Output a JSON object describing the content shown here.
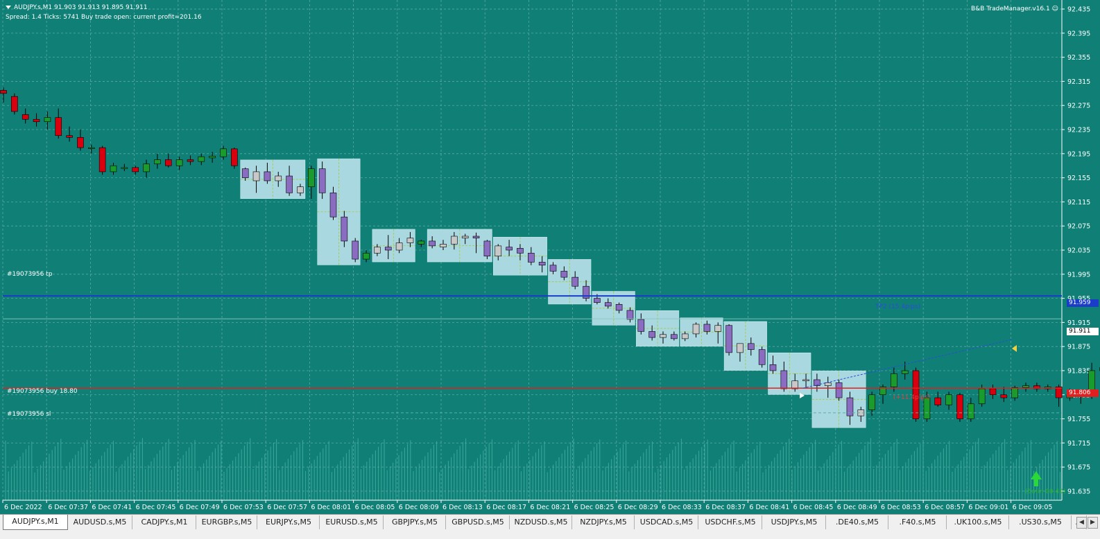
{
  "header": {
    "symbol_line": "AUDJPY.s,M1  91.903 91.913 91.895 91.911",
    "info_line": "Spread: 1.4   Ticks: 5741   Buy trade open: current profit=201.16",
    "ea_name": "B&B TradeManager.v16.1"
  },
  "price_axis": {
    "labels": [
      "92.435",
      "92.395",
      "92.355",
      "92.315",
      "92.275",
      "92.235",
      "92.195",
      "92.155",
      "92.115",
      "92.075",
      "92.035",
      "91.995",
      "91.955",
      "91.915",
      "91.875",
      "91.835",
      "91.795",
      "91.755",
      "91.715",
      "91.675",
      "91.635"
    ],
    "current_price": "91.911",
    "tp_price": "91.959",
    "entry_price": "91.806"
  },
  "time_axis": {
    "labels": [
      "6 Dec 2022",
      "6 Dec 07:37",
      "6 Dec 07:41",
      "6 Dec 07:45",
      "6 Dec 07:49",
      "6 Dec 07:53",
      "6 Dec 07:57",
      "6 Dec 08:01",
      "6 Dec 08:05",
      "6 Dec 08:09",
      "6 Dec 08:13",
      "6 Dec 08:17",
      "6 Dec 08:21",
      "6 Dec 08:25",
      "6 Dec 08:29",
      "6 Dec 08:33",
      "6 Dec 08:37",
      "6 Dec 08:41",
      "6 Dec 08:45",
      "6 Dec 08:49",
      "6 Dec 08:53",
      "6 Dec 08:57",
      "6 Dec 09:01",
      "6 Dec 09:05"
    ]
  },
  "trade_labels": {
    "tp": "#19073956 tp",
    "buy": "#19073956 buy 18.80",
    "sl": "#19073956 sl",
    "tp2": "TP2 (15.4pips)",
    "entry_tag": "(+11.4pips)",
    "timer": "(5min 08:40)"
  },
  "colors": {
    "background": "#108077",
    "bull": "#1a9c2c",
    "bear": "#d8000e",
    "box": "#a9d8e0",
    "box_candle": "#8a6cc0",
    "tp_line": "#1a3cc8",
    "entry_line": "#e02020",
    "grid": "#5aa8a0"
  },
  "tabs": [
    "AUDJPY.s,M1",
    "AUDUSD.s,M5",
    "CADJPY.s,M1",
    "EURGBP.s,M5",
    "EURJPY.s,M5",
    "EURUSD.s,M5",
    "GBPJPY.s,M5",
    "GBPUSD.s,M5",
    "NZDUSD.s,M5",
    "NZDJPY.s,M5",
    "USDCAD.s,M5",
    "USDCHF.s,M5",
    "USDJPY.s,M5",
    ".DE40.s,M5",
    ".F40.s,M5",
    ".UK100.s,M5",
    ".US30.s,M5",
    ".U"
  ],
  "active_tab": "AUDJPY.s,M1",
  "chart_data": {
    "type": "candlestick",
    "candles": [
      {
        "o": 92.3,
        "h": 92.305,
        "l": 92.28,
        "c": 92.295
      },
      {
        "o": 92.29,
        "h": 92.295,
        "l": 92.26,
        "c": 92.265
      },
      {
        "o": 92.26,
        "h": 92.27,
        "l": 92.245,
        "c": 92.252
      },
      {
        "o": 92.252,
        "h": 92.262,
        "l": 92.24,
        "c": 92.248
      },
      {
        "o": 92.248,
        "h": 92.265,
        "l": 92.235,
        "c": 92.255
      },
      {
        "o": 92.255,
        "h": 92.27,
        "l": 92.22,
        "c": 92.225
      },
      {
        "o": 92.225,
        "h": 92.24,
        "l": 92.215,
        "c": 92.222
      },
      {
        "o": 92.222,
        "h": 92.235,
        "l": 92.2,
        "c": 92.205
      },
      {
        "o": 92.205,
        "h": 92.21,
        "l": 92.195,
        "c": 92.205
      },
      {
        "o": 92.205,
        "h": 92.208,
        "l": 92.16,
        "c": 92.165
      },
      {
        "o": 92.165,
        "h": 92.18,
        "l": 92.16,
        "c": 92.175
      },
      {
        "o": 92.172,
        "h": 92.178,
        "l": 92.166,
        "c": 92.172
      },
      {
        "o": 92.172,
        "h": 92.175,
        "l": 92.16,
        "c": 92.165
      },
      {
        "o": 92.165,
        "h": 92.185,
        "l": 92.155,
        "c": 92.178
      },
      {
        "o": 92.178,
        "h": 92.195,
        "l": 92.17,
        "c": 92.185
      },
      {
        "o": 92.185,
        "h": 92.195,
        "l": 92.172,
        "c": 92.175
      },
      {
        "o": 92.175,
        "h": 92.19,
        "l": 92.168,
        "c": 92.185
      },
      {
        "o": 92.185,
        "h": 92.192,
        "l": 92.176,
        "c": 92.182
      },
      {
        "o": 92.182,
        "h": 92.195,
        "l": 92.176,
        "c": 92.19
      },
      {
        "o": 92.188,
        "h": 92.198,
        "l": 92.18,
        "c": 92.191
      },
      {
        "o": 92.19,
        "h": 92.208,
        "l": 92.185,
        "c": 92.203
      },
      {
        "o": 92.203,
        "h": 92.205,
        "l": 92.17,
        "c": 92.175
      },
      {
        "o": 92.17,
        "h": 92.172,
        "l": 92.15,
        "c": 92.155
      },
      {
        "o": 92.15,
        "h": 92.175,
        "l": 92.13,
        "c": 92.165
      },
      {
        "o": 92.165,
        "h": 92.18,
        "l": 92.145,
        "c": 92.15
      },
      {
        "o": 92.15,
        "h": 92.165,
        "l": 92.14,
        "c": 92.158
      },
      {
        "o": 92.158,
        "h": 92.175,
        "l": 92.125,
        "c": 92.13
      },
      {
        "o": 92.13,
        "h": 92.145,
        "l": 92.125,
        "c": 92.14
      },
      {
        "o": 92.14,
        "h": 92.175,
        "l": 92.12,
        "c": 92.17
      },
      {
        "o": 92.17,
        "h": 92.182,
        "l": 92.12,
        "c": 92.13
      },
      {
        "o": 92.13,
        "h": 92.14,
        "l": 92.085,
        "c": 92.09
      },
      {
        "o": 92.09,
        "h": 92.1,
        "l": 92.04,
        "c": 92.05
      },
      {
        "o": 92.05,
        "h": 92.055,
        "l": 92.015,
        "c": 92.02
      },
      {
        "o": 92.02,
        "h": 92.035,
        "l": 92.015,
        "c": 92.03
      },
      {
        "o": 92.03,
        "h": 92.045,
        "l": 92.025,
        "c": 92.04
      },
      {
        "o": 92.04,
        "h": 92.06,
        "l": 92.02,
        "c": 92.035
      },
      {
        "o": 92.035,
        "h": 92.055,
        "l": 92.03,
        "c": 92.047
      },
      {
        "o": 92.047,
        "h": 92.065,
        "l": 92.04,
        "c": 92.055
      },
      {
        "o": 92.045,
        "h": 92.052,
        "l": 92.04,
        "c": 92.05
      },
      {
        "o": 92.05,
        "h": 92.058,
        "l": 92.038,
        "c": 92.042
      },
      {
        "o": 92.04,
        "h": 92.052,
        "l": 92.035,
        "c": 92.045
      },
      {
        "o": 92.045,
        "h": 92.065,
        "l": 92.036,
        "c": 92.058
      },
      {
        "o": 92.055,
        "h": 92.062,
        "l": 92.045,
        "c": 92.058
      },
      {
        "o": 92.058,
        "h": 92.064,
        "l": 92.03,
        "c": 92.055
      },
      {
        "o": 92.05,
        "h": 92.052,
        "l": 92.02,
        "c": 92.025
      },
      {
        "o": 92.025,
        "h": 92.045,
        "l": 92.018,
        "c": 92.042
      },
      {
        "o": 92.04,
        "h": 92.052,
        "l": 92.025,
        "c": 92.035
      },
      {
        "o": 92.038,
        "h": 92.045,
        "l": 92.018,
        "c": 92.03
      },
      {
        "o": 92.03,
        "h": 92.04,
        "l": 92.01,
        "c": 92.015
      },
      {
        "o": 92.015,
        "h": 92.025,
        "l": 91.998,
        "c": 92.01
      },
      {
        "o": 92.01,
        "h": 92.015,
        "l": 91.995,
        "c": 92.0
      },
      {
        "o": 92.0,
        "h": 92.008,
        "l": 91.985,
        "c": 91.99
      },
      {
        "o": 91.99,
        "h": 92.0,
        "l": 91.97,
        "c": 91.975
      },
      {
        "o": 91.975,
        "h": 91.985,
        "l": 91.95,
        "c": 91.955
      },
      {
        "o": 91.955,
        "h": 91.962,
        "l": 91.945,
        "c": 91.948
      },
      {
        "o": 91.948,
        "h": 91.955,
        "l": 91.938,
        "c": 91.942
      },
      {
        "o": 91.945,
        "h": 91.948,
        "l": 91.93,
        "c": 91.935
      },
      {
        "o": 91.935,
        "h": 91.94,
        "l": 91.915,
        "c": 91.92
      },
      {
        "o": 91.92,
        "h": 91.93,
        "l": 91.895,
        "c": 91.9
      },
      {
        "o": 91.9,
        "h": 91.91,
        "l": 91.885,
        "c": 91.89
      },
      {
        "o": 91.89,
        "h": 91.9,
        "l": 91.88,
        "c": 91.895
      },
      {
        "o": 91.895,
        "h": 91.9,
        "l": 91.885,
        "c": 91.888
      },
      {
        "o": 91.888,
        "h": 91.9,
        "l": 91.884,
        "c": 91.896
      },
      {
        "o": 91.896,
        "h": 91.915,
        "l": 91.89,
        "c": 91.912
      },
      {
        "o": 91.912,
        "h": 91.918,
        "l": 91.895,
        "c": 91.9
      },
      {
        "o": 91.9,
        "h": 91.915,
        "l": 91.88,
        "c": 91.91
      },
      {
        "o": 91.91,
        "h": 91.912,
        "l": 91.86,
        "c": 91.865
      },
      {
        "o": 91.865,
        "h": 91.88,
        "l": 91.85,
        "c": 91.88
      },
      {
        "o": 91.88,
        "h": 91.89,
        "l": 91.86,
        "c": 91.87
      },
      {
        "o": 91.87,
        "h": 91.875,
        "l": 91.84,
        "c": 91.845
      },
      {
        "o": 91.845,
        "h": 91.86,
        "l": 91.83,
        "c": 91.835
      },
      {
        "o": 91.835,
        "h": 91.85,
        "l": 91.8,
        "c": 91.805
      },
      {
        "o": 91.805,
        "h": 91.83,
        "l": 91.8,
        "c": 91.818
      },
      {
        "o": 91.818,
        "h": 91.83,
        "l": 91.805,
        "c": 91.82
      },
      {
        "o": 91.82,
        "h": 91.83,
        "l": 91.8,
        "c": 91.81
      },
      {
        "o": 91.81,
        "h": 91.825,
        "l": 91.79,
        "c": 91.815
      },
      {
        "o": 91.815,
        "h": 91.82,
        "l": 91.785,
        "c": 91.79
      },
      {
        "o": 91.79,
        "h": 91.8,
        "l": 91.745,
        "c": 91.76
      },
      {
        "o": 91.76,
        "h": 91.775,
        "l": 91.75,
        "c": 91.77
      },
      {
        "o": 91.77,
        "h": 91.8,
        "l": 91.76,
        "c": 91.795
      },
      {
        "o": 91.795,
        "h": 91.812,
        "l": 91.78,
        "c": 91.808
      },
      {
        "o": 91.808,
        "h": 91.84,
        "l": 91.8,
        "c": 91.83
      },
      {
        "o": 91.83,
        "h": 91.85,
        "l": 91.82,
        "c": 91.835
      },
      {
        "o": 91.835,
        "h": 91.84,
        "l": 91.75,
        "c": 91.755
      },
      {
        "o": 91.755,
        "h": 91.8,
        "l": 91.75,
        "c": 91.79
      },
      {
        "o": 91.79,
        "h": 91.8,
        "l": 91.775,
        "c": 91.778
      },
      {
        "o": 91.778,
        "h": 91.8,
        "l": 91.77,
        "c": 91.795
      },
      {
        "o": 91.795,
        "h": 91.798,
        "l": 91.75,
        "c": 91.755
      },
      {
        "o": 91.755,
        "h": 91.79,
        "l": 91.75,
        "c": 91.78
      },
      {
        "o": 91.78,
        "h": 91.812,
        "l": 91.775,
        "c": 91.805
      },
      {
        "o": 91.805,
        "h": 91.812,
        "l": 91.788,
        "c": 91.795
      },
      {
        "o": 91.795,
        "h": 91.808,
        "l": 91.783,
        "c": 91.79
      },
      {
        "o": 91.79,
        "h": 91.81,
        "l": 91.785,
        "c": 91.807
      },
      {
        "o": 91.807,
        "h": 91.815,
        "l": 91.8,
        "c": 91.81
      },
      {
        "o": 91.81,
        "h": 91.815,
        "l": 91.8,
        "c": 91.805
      },
      {
        "o": 91.805,
        "h": 91.812,
        "l": 91.8,
        "c": 91.808
      },
      {
        "o": 91.808,
        "h": 91.812,
        "l": 91.775,
        "c": 91.79
      },
      {
        "o": 91.79,
        "h": 91.805,
        "l": 91.785,
        "c": 91.795
      },
      {
        "o": 91.795,
        "h": 91.8,
        "l": 91.78,
        "c": 91.793
      },
      {
        "o": 91.793,
        "h": 91.848,
        "l": 91.788,
        "c": 91.835
      },
      {
        "o": 91.835,
        "h": 91.845,
        "l": 91.825,
        "c": 91.84
      },
      {
        "o": 91.84,
        "h": 91.87,
        "l": 91.83,
        "c": 91.865
      },
      {
        "o": 91.865,
        "h": 91.88,
        "l": 91.855,
        "c": 91.866
      },
      {
        "o": 91.866,
        "h": 91.895,
        "l": 91.852,
        "c": 91.89
      },
      {
        "o": 91.89,
        "h": 91.915,
        "l": 91.885,
        "c": 91.908
      },
      {
        "o": 91.903,
        "h": 91.913,
        "l": 91.895,
        "c": 91.911
      }
    ],
    "gray_ranges": [
      [
        22,
        27
      ],
      [
        29,
        32
      ],
      [
        34,
        37
      ],
      [
        39,
        44
      ],
      [
        45,
        49
      ],
      [
        50,
        53
      ],
      [
        54,
        57
      ],
      [
        58,
        61
      ],
      [
        62,
        65
      ],
      [
        66,
        69
      ],
      [
        70,
        73
      ],
      [
        74,
        78
      ]
    ],
    "tp_level": 91.959,
    "entry_level": 91.806,
    "sl_level": 91.765,
    "y_range": [
      91.62,
      92.45
    ]
  }
}
